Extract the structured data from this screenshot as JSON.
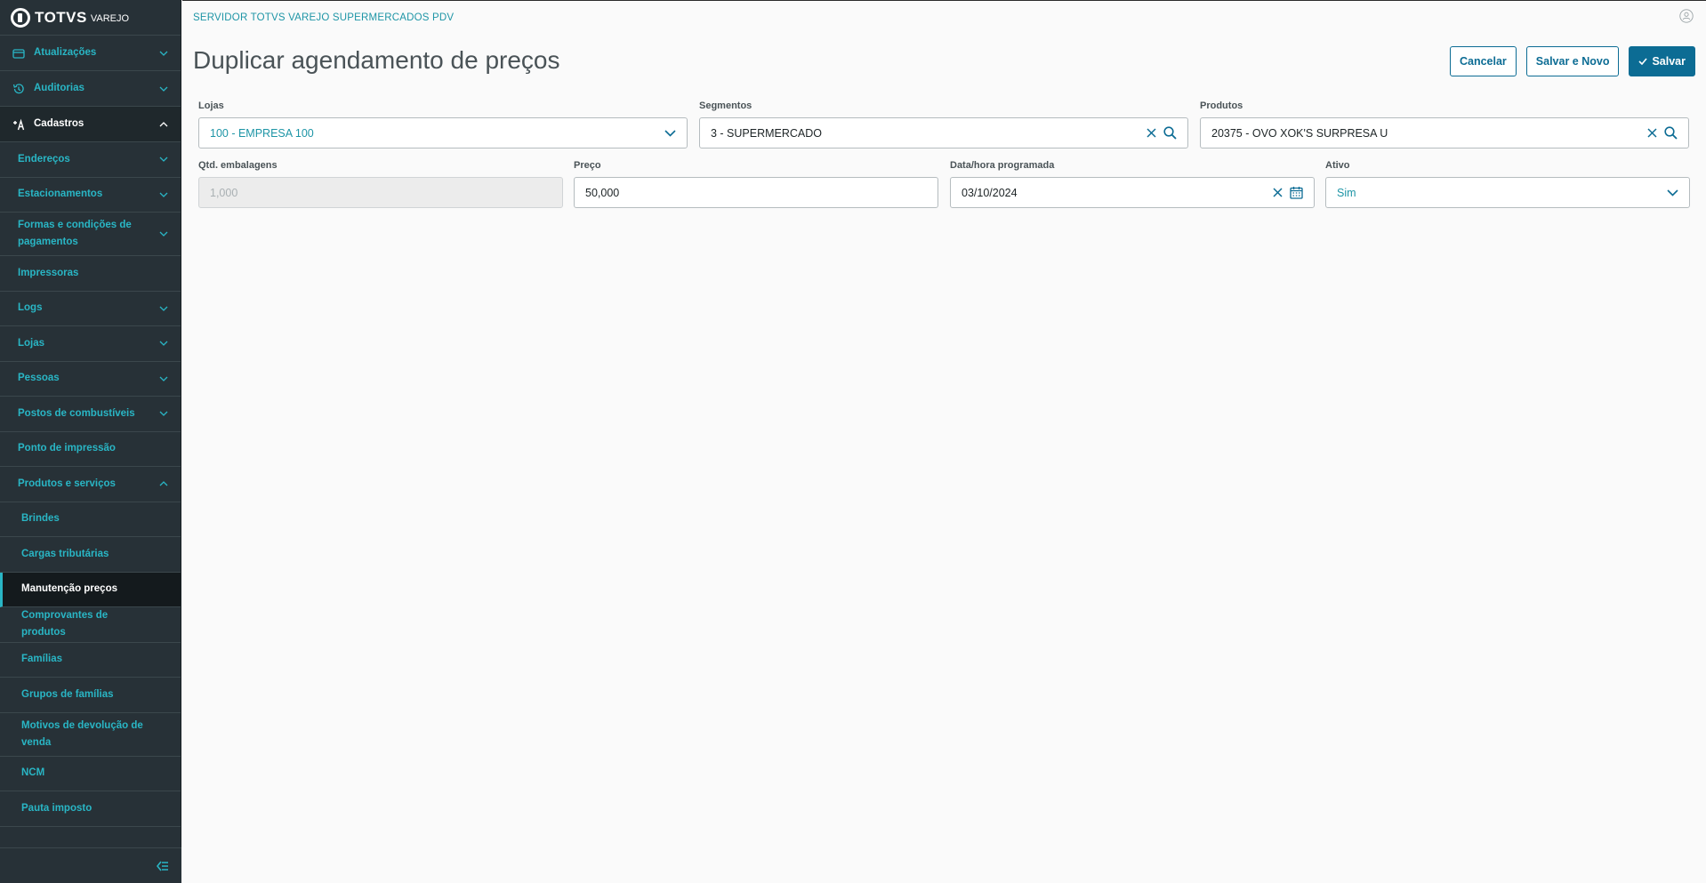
{
  "brand": {
    "name": "TOTVS",
    "product": "VAREJO"
  },
  "sidebar": {
    "items": [
      {
        "label": "Atualizações",
        "level": "top",
        "icon": "card-icon",
        "expanded": false
      },
      {
        "label": "Auditorias",
        "level": "top",
        "icon": "history-icon",
        "expanded": false
      },
      {
        "label": "Cadastros",
        "level": "top",
        "icon": "add-user-icon",
        "expanded": true
      },
      {
        "label": "Endereços",
        "level": "child",
        "expanded": false
      },
      {
        "label": "Estacionamentos",
        "level": "child",
        "expanded": false
      },
      {
        "label": "Formas e condições de pagamentos",
        "level": "child",
        "expanded": false
      },
      {
        "label": "Impressoras",
        "level": "child",
        "leaf": true
      },
      {
        "label": "Logs",
        "level": "child",
        "expanded": false
      },
      {
        "label": "Lojas",
        "level": "child",
        "expanded": false
      },
      {
        "label": "Pessoas",
        "level": "child",
        "expanded": false
      },
      {
        "label": "Postos de combustíveis",
        "level": "child",
        "expanded": false
      },
      {
        "label": "Ponto de impressão",
        "level": "child",
        "leaf": true
      },
      {
        "label": "Produtos e serviços",
        "level": "child",
        "expanded": true
      },
      {
        "label": "Brindes",
        "level": "sub",
        "leaf": true
      },
      {
        "label": "Cargas tributárias",
        "level": "sub",
        "leaf": true
      },
      {
        "label": "Manutenção preços",
        "level": "sub",
        "leaf": true,
        "selected": true
      },
      {
        "label": "Comprovantes de produtos",
        "level": "sub",
        "leaf": true
      },
      {
        "label": "Famílias",
        "level": "sub",
        "leaf": true
      },
      {
        "label": "Grupos de famílias",
        "level": "sub",
        "leaf": true
      },
      {
        "label": "Motivos de devolução de venda",
        "level": "sub",
        "leaf": true
      },
      {
        "label": "NCM",
        "level": "sub",
        "leaf": true
      },
      {
        "label": "Pauta imposto",
        "level": "sub",
        "leaf": true
      }
    ]
  },
  "header": {
    "server": "SERVIDOR TOTVS VAREJO SUPERMERCADOS PDV"
  },
  "page": {
    "title": "Duplicar agendamento de preços",
    "buttons": {
      "cancel": "Cancelar",
      "save_new": "Salvar e Novo",
      "save": "Salvar"
    }
  },
  "form": {
    "lojas": {
      "label": "Lojas",
      "value": "100 - EMPRESA 100"
    },
    "segmentos": {
      "label": "Segmentos",
      "value": "3 - SUPERMERCADO"
    },
    "produtos": {
      "label": "Produtos",
      "value": "20375 - OVO XOK'S SURPRESA U"
    },
    "qtd": {
      "label": "Qtd. embalagens",
      "value": "1,000"
    },
    "preco": {
      "label": "Preço",
      "value": "50,000"
    },
    "data": {
      "label": "Data/hora programada",
      "value": "03/10/2024"
    },
    "ativo": {
      "label": "Ativo",
      "value": "Sim"
    }
  },
  "colors": {
    "sidebar_bg": "#273137",
    "accent": "#29b6c5",
    "primary": "#0c6c94"
  }
}
